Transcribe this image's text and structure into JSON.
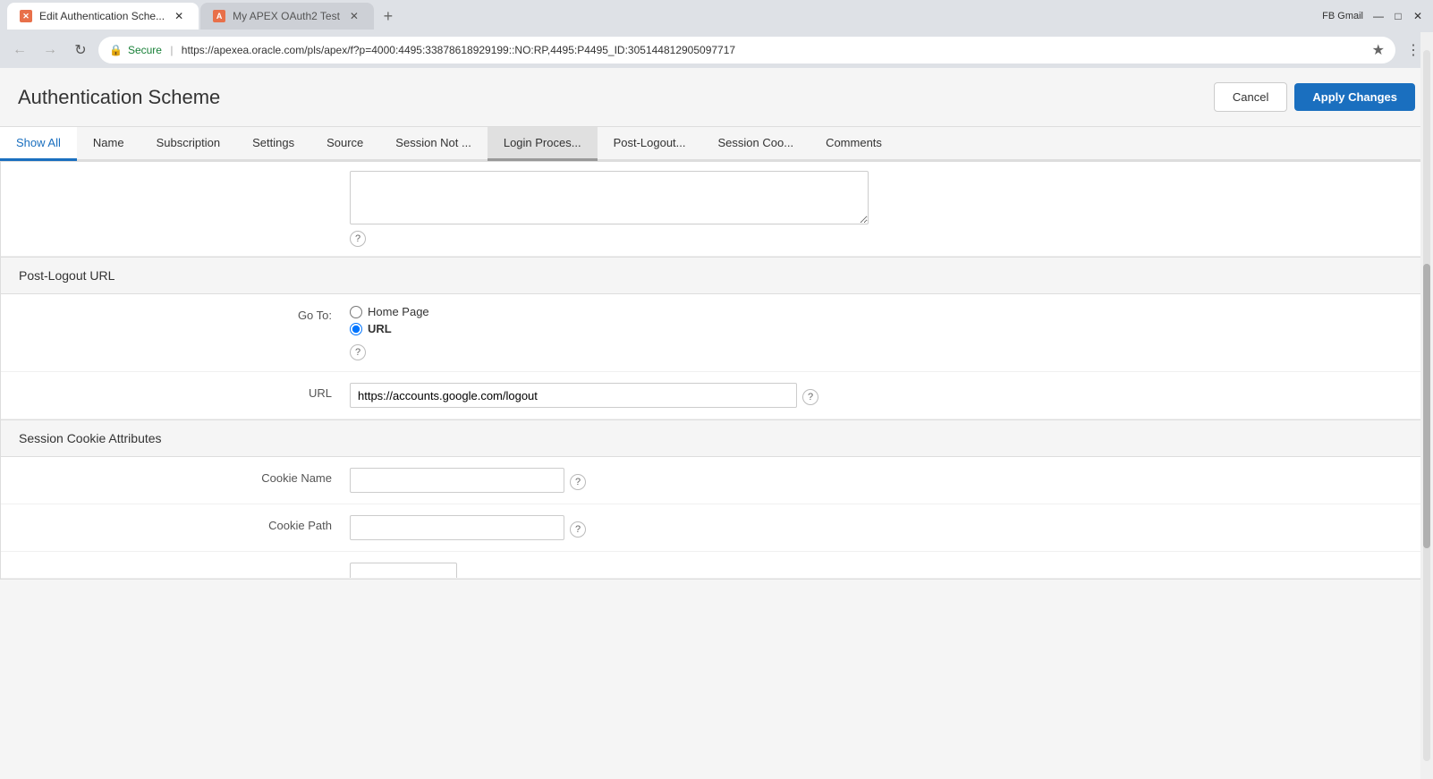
{
  "browser": {
    "profile_label": "FB Gmail",
    "tabs": [
      {
        "id": "tab1",
        "favicon_type": "apex",
        "favicon_text": "✕",
        "label": "Edit Authentication Sche...",
        "active": true
      },
      {
        "id": "tab2",
        "favicon_type": "apex",
        "favicon_text": "✕",
        "label": "My APEX OAuth2 Test",
        "active": false
      }
    ],
    "url": "https://apexea.oracle.com/pls/apex/f?p=4000:4495:33878618929199::NO:RP,4495:P4495_ID:305144812905097717",
    "secure_label": "Secure",
    "window_controls": {
      "minimize": "—",
      "maximize": "□",
      "close": "✕"
    }
  },
  "page": {
    "title": "Authentication Scheme",
    "cancel_label": "Cancel",
    "apply_label": "Apply Changes"
  },
  "tabs": {
    "items": [
      {
        "id": "show-all",
        "label": "Show All",
        "active": true
      },
      {
        "id": "name",
        "label": "Name",
        "active": false
      },
      {
        "id": "subscription",
        "label": "Subscription",
        "active": false
      },
      {
        "id": "settings",
        "label": "Settings",
        "active": false
      },
      {
        "id": "source",
        "label": "Source",
        "active": false
      },
      {
        "id": "session-not",
        "label": "Session Not ...",
        "active": false
      },
      {
        "id": "login-process",
        "label": "Login Proces...",
        "active": false,
        "selected": true
      },
      {
        "id": "post-logout",
        "label": "Post-Logout...",
        "active": false
      },
      {
        "id": "session-coo",
        "label": "Session Coo...",
        "active": false
      },
      {
        "id": "comments",
        "label": "Comments",
        "active": false
      }
    ]
  },
  "form": {
    "textarea_placeholder": "",
    "help_icon_label": "?",
    "post_logout_section": "Post-Logout URL",
    "go_to_label": "Go To:",
    "radio_home_page": "Home Page",
    "radio_url": "URL",
    "url_label": "URL",
    "url_value": "https://accounts.google.com/logout",
    "session_cookie_section": "Session Cookie Attributes",
    "cookie_name_label": "Cookie Name",
    "cookie_path_label": "Cookie Path",
    "cookie_name_value": "",
    "cookie_path_value": ""
  }
}
